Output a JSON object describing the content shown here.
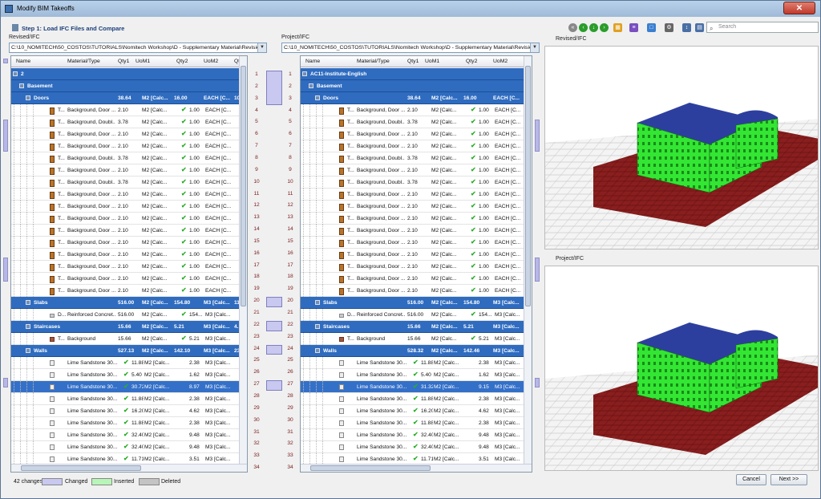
{
  "window": {
    "title": "Modify BIM Takeoffs"
  },
  "step": {
    "title": "Step 1: Load IFC Files and Compare"
  },
  "toolbar": {
    "search_placeholder": "Search"
  },
  "left": {
    "label": "Revised/IFC",
    "path": "C:\\10_NOMITECH\\50_COSTOS\\TUTORIALS\\Nomitech Workshop\\D - Supplementary Material\\Revisio...",
    "root": "2"
  },
  "right": {
    "label": "Project/IFC",
    "path": "C:\\10_NOMITECH\\50_COSTOS\\TUTORIALS\\Nomitech Workshop\\D - Supplementary Material\\Revisio...",
    "root": "AC11-Institute-English"
  },
  "columns": [
    "Name",
    "Material/Type",
    "Qty1",
    "UoM1",
    "Qty2",
    "UoM2",
    "Qt"
  ],
  "groups": {
    "basement": "Basement",
    "doors": {
      "name": "Doors",
      "qty1": "38.64",
      "uom1": "M2 [Calc...",
      "qty2": "16.00",
      "uom2": "EACH [C...",
      "extra": "104"
    },
    "slabs": {
      "name": "Slabs",
      "qty1": "516.00",
      "uom1": "M2 [Calc...",
      "qty2": "154.80",
      "uom2": "M3 [Calc...",
      "extra": "112"
    },
    "stairs": {
      "name": "Staircases",
      "qty1": "15.66",
      "uom1": "M2 [Calc...",
      "qty2": "5.21",
      "uom2": "M3 [Calc...",
      "extra": "4.1"
    },
    "walls_left": {
      "name": "Walls",
      "qty1": "527.13",
      "uom1": "M2 [Calc...",
      "qty2": "142.10",
      "uom2": "M3 [Calc...",
      "extra": "234"
    },
    "walls_right": {
      "name": "Walls",
      "qty1": "528.32",
      "uom1": "M2 [Calc...",
      "qty2": "142.46",
      "uom2": "M3 [Calc...",
      "extra": "234"
    }
  },
  "door_rows": [
    [
      "T...",
      "Background, Door ...",
      "2.10",
      "M2 [Calc...",
      "1.00",
      "EACH [C..."
    ],
    [
      "T...",
      "Background, Doubl...",
      "3.78",
      "M2 [Calc...",
      "1.00",
      "EACH [C..."
    ],
    [
      "T...",
      "Background, Door ...",
      "2.10",
      "M2 [Calc...",
      "1.00",
      "EACH [C..."
    ],
    [
      "T...",
      "Background, Door ...",
      "2.10",
      "M2 [Calc...",
      "1.00",
      "EACH [C..."
    ],
    [
      "T...",
      "Background, Doubl...",
      "3.78",
      "M2 [Calc...",
      "1.00",
      "EACH [C..."
    ],
    [
      "T...",
      "Background, Door ...",
      "2.10",
      "M2 [Calc...",
      "1.00",
      "EACH [C..."
    ],
    [
      "T...",
      "Background, Doubl...",
      "3.78",
      "M2 [Calc...",
      "1.00",
      "EACH [C..."
    ],
    [
      "T...",
      "Background, Door ...",
      "2.10",
      "M2 [Calc...",
      "1.00",
      "EACH [C..."
    ],
    [
      "T...",
      "Background, Door ...",
      "2.10",
      "M2 [Calc...",
      "1.00",
      "EACH [C..."
    ],
    [
      "T...",
      "Background, Door ...",
      "2.10",
      "M2 [Calc...",
      "1.00",
      "EACH [C..."
    ],
    [
      "T...",
      "Background, Door ...",
      "2.10",
      "M2 [Calc...",
      "1.00",
      "EACH [C..."
    ],
    [
      "T...",
      "Background, Door ...",
      "2.10",
      "M2 [Calc...",
      "1.00",
      "EACH [C..."
    ],
    [
      "T...",
      "Background, Door ...",
      "2.10",
      "M2 [Calc...",
      "1.00",
      "EACH [C..."
    ],
    [
      "T...",
      "Background, Door ...",
      "2.10",
      "M2 [Calc...",
      "1.00",
      "EACH [C..."
    ],
    [
      "T...",
      "Background, Door ...",
      "2.10",
      "M2 [Calc...",
      "1.00",
      "EACH [C..."
    ],
    [
      "T...",
      "Background, Door ...",
      "2.10",
      "M2 [Calc...",
      "1.00",
      "EACH [C..."
    ]
  ],
  "slab_row": {
    "left": [
      "D...",
      "Reinforced Concret...",
      "516.00",
      "M2 [Calc...",
      "154...",
      "M3 [Calc..."
    ],
    "right": [
      "D...",
      "Reinforced Concret...",
      "516.00",
      "M2 [Calc...",
      "154...",
      "M3 [Calc..."
    ]
  },
  "stair_row": {
    "left": [
      "T...",
      "Background",
      "15.66",
      "M2 [Calc...",
      "5.21",
      "M3 [Calc..."
    ],
    "right": [
      "T...",
      "Background",
      "15.66",
      "M2 [Calc...",
      "5.21",
      "M3 [Calc..."
    ]
  },
  "wall_rows_left": [
    [
      "Lime Sandstone 30...",
      "11.88",
      "M2 [Calc...",
      "2.38",
      "M3 [Calc..."
    ],
    [
      "Lime Sandstone 30...",
      "5.40",
      "M2 [Calc...",
      "1.62",
      "M3 [Calc..."
    ],
    [
      "Lime Sandstone 30...",
      "30.72",
      "M2 [Calc...",
      "8.97",
      "M3 [Calc..."
    ],
    [
      "Lime Sandstone 30...",
      "11.88",
      "M2 [Calc...",
      "2.38",
      "M3 [Calc..."
    ],
    [
      "Lime Sandstone 30...",
      "16.20",
      "M2 [Calc...",
      "4.62",
      "M3 [Calc..."
    ],
    [
      "Lime Sandstone 30...",
      "11.88",
      "M2 [Calc...",
      "2.38",
      "M3 [Calc..."
    ],
    [
      "Lime Sandstone 30...",
      "32.40",
      "M2 [Calc...",
      "9.48",
      "M3 [Calc..."
    ],
    [
      "Lime Sandstone 30...",
      "32.40",
      "M2 [Calc...",
      "9.48",
      "M3 [Calc..."
    ],
    [
      "Lime Sandstone 30...",
      "11.71",
      "M2 [Calc...",
      "3.51",
      "M3 [Calc..."
    ]
  ],
  "wall_rows_right": [
    [
      "Lime Sandstone 30...",
      "11.88",
      "M2 [Calc...",
      "2.38",
      "M3 [Calc..."
    ],
    [
      "Lime Sandstone 30...",
      "5.40",
      "M2 [Calc...",
      "1.62",
      "M3 [Calc..."
    ],
    [
      "Lime Sandstone 30...",
      "31.32",
      "M2 [Calc...",
      "9.15",
      "M3 [Calc..."
    ],
    [
      "Lime Sandstone 30...",
      "11.88",
      "M2 [Calc...",
      "2.38",
      "M3 [Calc..."
    ],
    [
      "Lime Sandstone 30...",
      "16.20",
      "M2 [Calc...",
      "4.62",
      "M3 [Calc..."
    ],
    [
      "Lime Sandstone 30...",
      "11.88",
      "M2 [Calc...",
      "2.38",
      "M3 [Calc..."
    ],
    [
      "Lime Sandstone 30...",
      "32.40",
      "M2 [Calc...",
      "9.48",
      "M3 [Calc..."
    ],
    [
      "Lime Sandstone 30...",
      "32.40",
      "M2 [Calc...",
      "9.48",
      "M3 [Calc..."
    ],
    [
      "Lime Sandstone 30...",
      "11.71",
      "M2 [Calc...",
      "3.51",
      "M3 [Calc..."
    ]
  ],
  "line_numbers": [
    "1",
    "2",
    "3",
    "4",
    "5",
    "6",
    "7",
    "8",
    "9",
    "10",
    "11",
    "12",
    "13",
    "14",
    "15",
    "16",
    "17",
    "18",
    "19",
    "20",
    "21",
    "22",
    "23",
    "24",
    "25",
    "26",
    "27",
    "28",
    "29",
    "30",
    "31",
    "32",
    "33",
    "34"
  ],
  "viewers": {
    "top": "Revised/IFC",
    "bottom": "Project/IFC"
  },
  "status": {
    "changes": "42 changes",
    "changed": "Changed",
    "inserted": "Inserted",
    "deleted": "Deleted"
  },
  "buttons": {
    "cancel": "Cancel",
    "next": "Next >>"
  },
  "colors": {
    "accent": "#2f6cc0",
    "changed": "#c8c8f0",
    "inserted": "#b8f5b8",
    "deleted": "#c4c4c4",
    "building": "#33e633",
    "roof": "#2d3f9e",
    "ground": "#8a1e1e"
  }
}
